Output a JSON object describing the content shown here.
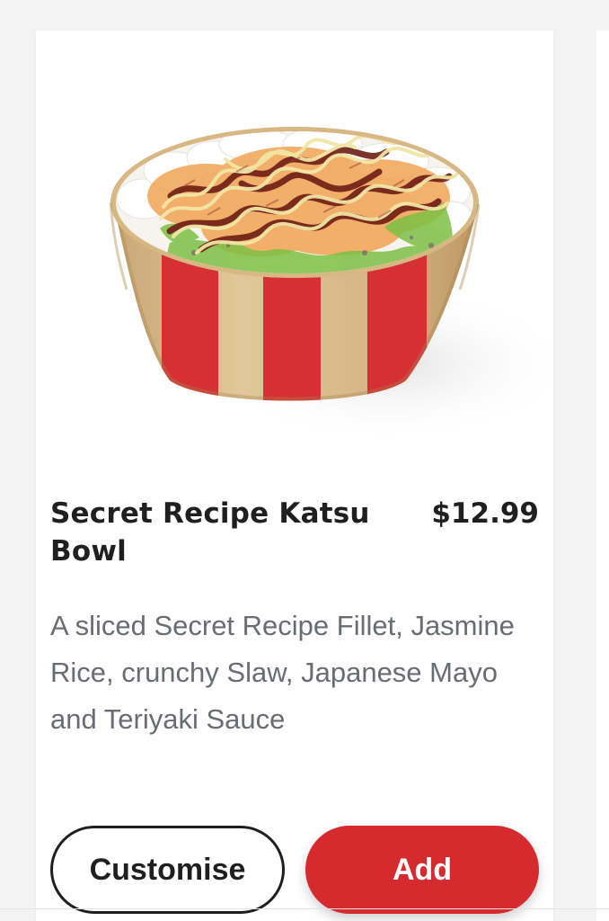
{
  "product": {
    "name": "Secret Recipe Katsu Bowl",
    "price": "$12.99",
    "description": "A sliced Secret Recipe Fillet, Jasmine Rice, crunchy Slaw, Japanese Mayo and Teriyaki Sauce",
    "image_icon": "katsu-bowl-image"
  },
  "actions": {
    "customise_label": "Customise",
    "add_label": "Add"
  },
  "colors": {
    "background": "#f3f3f4",
    "card": "#ffffff",
    "text_primary": "#1f1f1f",
    "text_secondary": "#6a6c73",
    "brand_red": "#d52b2f",
    "bowl_kraft": "#dbbf91"
  }
}
